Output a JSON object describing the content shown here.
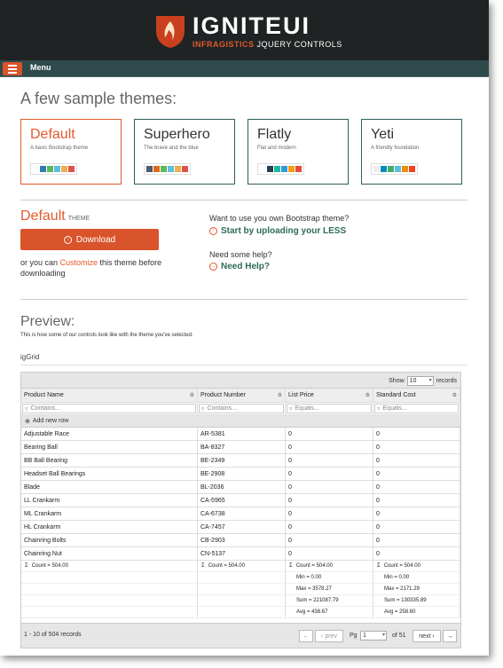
{
  "brand": {
    "name": "IGNITEUI",
    "sub_brand": "INFRAGISTICS",
    "sub_rest": " JQUERY CONTROLS"
  },
  "menu": {
    "label": "Menu"
  },
  "themes_heading": "A few sample themes:",
  "themes": [
    {
      "name": "Default",
      "desc": "A basic Bootstrap theme",
      "colors": [
        "#ffffff",
        "#337ab7",
        "#5cb85c",
        "#5bc0de",
        "#f0ad4e",
        "#d9534f"
      ]
    },
    {
      "name": "Superhero",
      "desc": "The brave and the blue",
      "colors": [
        "#4e5d6c",
        "#df691a",
        "#5cb85c",
        "#5bc0de",
        "#f0ad4e",
        "#d9534f"
      ]
    },
    {
      "name": "Flatly",
      "desc": "Flat and modern",
      "colors": [
        "#ffffff",
        "#2c3e50",
        "#18bc9c",
        "#3498db",
        "#f39c12",
        "#e74c3c"
      ]
    },
    {
      "name": "Yeti",
      "desc": "A friendly foundation",
      "colors": [
        "#eeeeee",
        "#008cba",
        "#43ac6a",
        "#5bc0de",
        "#e99002",
        "#f04124"
      ]
    }
  ],
  "selected": {
    "name": "Default",
    "suffix": "THEME"
  },
  "download_label": "Download",
  "customize": {
    "pre": "or you can ",
    "link": "Customize",
    "post": " this theme before downloading"
  },
  "right": {
    "q1": "Want to use you own Bootstrap theme?",
    "link1": "Start by uploading your LESS",
    "q2": "Need some help?",
    "link2": "Need Help?"
  },
  "preview": {
    "title": "Preview:",
    "desc": "This is how some of our controls look like with the theme you've selected.",
    "grid_label": "igGrid"
  },
  "grid": {
    "show_label": "Show",
    "page_size": "10",
    "records_label": "records",
    "columns": [
      "Product Name",
      "Product Number",
      "List Price",
      "Standard Cost"
    ],
    "filters": [
      "Contains...",
      "Contains...",
      "Equals...",
      "Equals..."
    ],
    "add_row": "Add new row",
    "rows": [
      [
        "Adjustable Race",
        "AR-5381",
        "0",
        "0"
      ],
      [
        "Bearing Ball",
        "BA-8327",
        "0",
        "0"
      ],
      [
        "BB Ball Bearing",
        "BE-2349",
        "0",
        "0"
      ],
      [
        "Headset Ball Bearings",
        "BE-2908",
        "0",
        "0"
      ],
      [
        "Blade",
        "BL-2036",
        "0",
        "0"
      ],
      [
        "LL Crankarm",
        "CA-5965",
        "0",
        "0"
      ],
      [
        "ML Crankarm",
        "CA-6738",
        "0",
        "0"
      ],
      [
        "HL Crankarm",
        "CA-7457",
        "0",
        "0"
      ],
      [
        "Chainring Bolts",
        "CB-2903",
        "0",
        "0"
      ],
      [
        "Chainring Nut",
        "CN-5137",
        "0",
        "0"
      ]
    ],
    "summaries": {
      "c1": "Count = 504.00",
      "c2": "Count = 504.00",
      "c3": [
        "Count = 504.00",
        "Min = 0.00",
        "Max = 3578.27",
        "Sum = 221087.79",
        "Avg = 438.67"
      ],
      "c4": [
        "Count = 504.00",
        "Min = 0.00",
        "Max = 2171.29",
        "Sum = 130335.89",
        "Avg = 258.60"
      ]
    },
    "pager": {
      "info": "1 - 10 of 504 records",
      "prev": "prev",
      "pg": "Pg",
      "page": "1",
      "of": "of 51",
      "next": "next"
    }
  }
}
